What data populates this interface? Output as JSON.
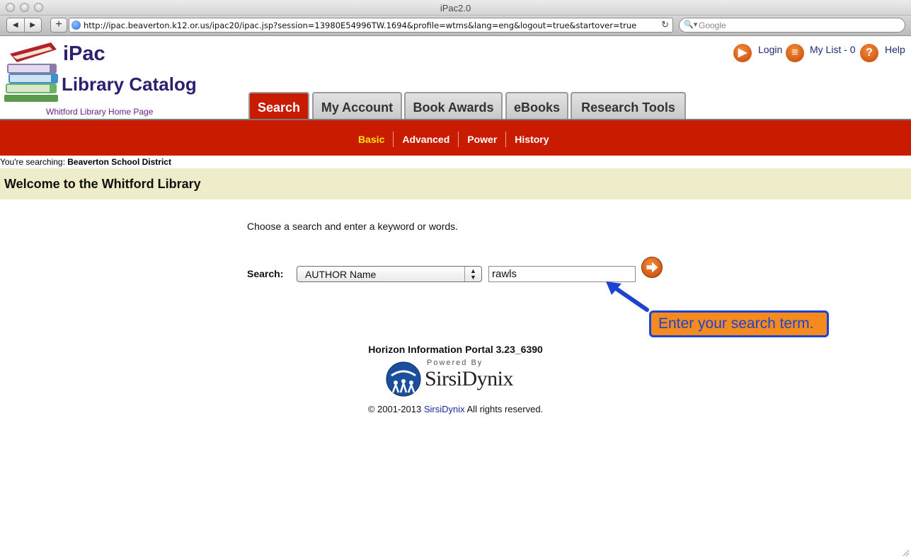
{
  "browser": {
    "window_title": "iPac2.0",
    "url": "http://ipac.beaverton.k12.or.us/ipac20/ipac.jsp?session=13980E54996TW.1694&profile=wtms&lang=eng&logout=true&startover=true",
    "search_placeholder": "Google"
  },
  "header": {
    "logo_line1": "iPac",
    "logo_line2": "Library Catalog",
    "home_link": "Whitford Library Home Page",
    "top_links": {
      "login": "Login",
      "my_list": "My List - 0",
      "help": "Help"
    }
  },
  "tabs": [
    {
      "label": "Search",
      "active": true
    },
    {
      "label": "My Account"
    },
    {
      "label": "Book Awards"
    },
    {
      "label": "eBooks"
    },
    {
      "label": "Research Tools"
    }
  ],
  "subnav": [
    {
      "label": "Basic",
      "current": true
    },
    {
      "label": "Advanced"
    },
    {
      "label": "Power"
    },
    {
      "label": "History"
    }
  ],
  "context": {
    "prefix": "You're searching:",
    "library": "Beaverton School District"
  },
  "welcome": "Welcome to the Whitford Library",
  "search_form": {
    "instructions": "Choose a search and enter a keyword or words.",
    "label": "Search:",
    "selected_type": "AUTHOR Name",
    "term": "rawls"
  },
  "callout": "Enter your search term.",
  "footer": {
    "version": "Horizon Information Portal 3.23_6390",
    "powered_by": "Powered By",
    "brand": "SirsiDynix",
    "copyright_prefix": "© 2001-2013",
    "copyright_link": "SirsiDynix",
    "copyright_suffix": "All rights reserved."
  },
  "colors": {
    "accent_red": "#c81b00",
    "current_subnav": "#ffe600",
    "welcome_band": "#efecc9",
    "callout_fill": "#f58a1f",
    "callout_border": "#1f43d1"
  }
}
